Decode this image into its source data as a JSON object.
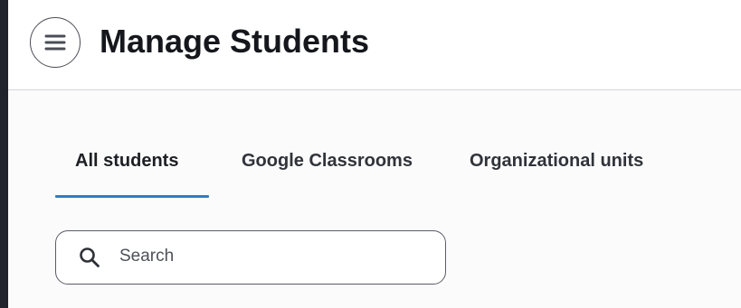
{
  "header": {
    "title": "Manage Students",
    "menu_icon": "hamburger-menu-icon"
  },
  "tabs": {
    "items": [
      {
        "label": "All students",
        "active": true
      },
      {
        "label": "Google Classrooms",
        "active": false
      },
      {
        "label": "Organizational units",
        "active": false
      }
    ]
  },
  "search": {
    "placeholder": "Search",
    "value": "",
    "icon": "search-icon"
  },
  "colors": {
    "left_rail": "#20232b",
    "active_tab_indicator": "#2f7fc0",
    "header_border": "#d4d6dc"
  }
}
